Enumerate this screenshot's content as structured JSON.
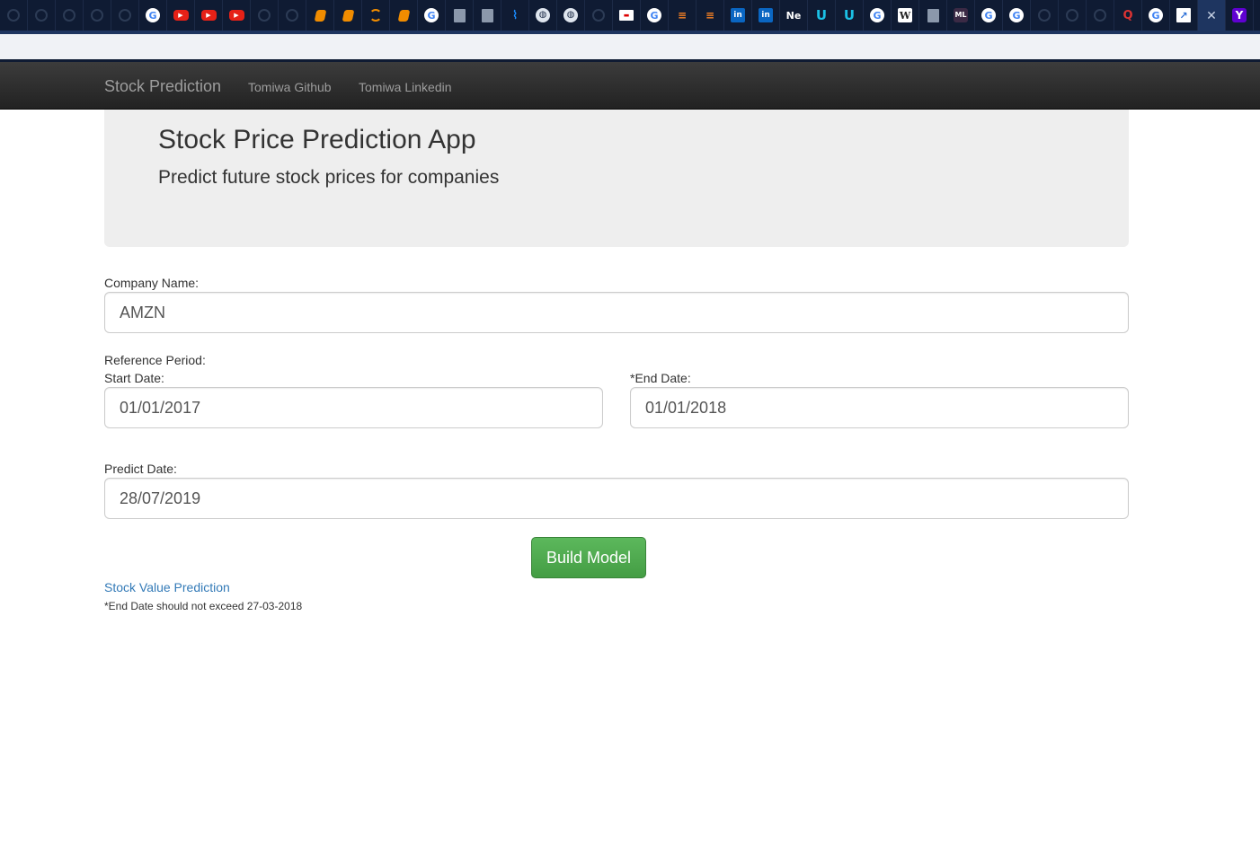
{
  "browser": {
    "tabs": [
      {
        "icon": "github-icon",
        "glyph": ""
      },
      {
        "icon": "github-icon",
        "glyph": ""
      },
      {
        "icon": "github-icon",
        "glyph": ""
      },
      {
        "icon": "github-icon",
        "glyph": ""
      },
      {
        "icon": "github-icon",
        "glyph": ""
      },
      {
        "icon": "google-icon",
        "glyph": "G"
      },
      {
        "icon": "youtube-icon",
        "glyph": "▶"
      },
      {
        "icon": "youtube-icon",
        "glyph": "▶"
      },
      {
        "icon": "youtube-icon",
        "glyph": "▶"
      },
      {
        "icon": "github-icon",
        "glyph": ""
      },
      {
        "icon": "github-icon",
        "glyph": ""
      },
      {
        "icon": "book-icon",
        "glyph": ""
      },
      {
        "icon": "book-icon",
        "glyph": ""
      },
      {
        "icon": "loader-icon",
        "glyph": ""
      },
      {
        "icon": "book-icon",
        "glyph": ""
      },
      {
        "icon": "google-icon",
        "glyph": "G"
      },
      {
        "icon": "document-icon",
        "glyph": ""
      },
      {
        "icon": "document-icon",
        "glyph": ""
      },
      {
        "icon": "chart-icon",
        "glyph": "⌇"
      },
      {
        "icon": "globe-icon",
        "glyph": "◍"
      },
      {
        "icon": "globe-icon",
        "glyph": "◍"
      },
      {
        "icon": "github-icon",
        "glyph": ""
      },
      {
        "icon": "red-banner-icon",
        "glyph": "▬"
      },
      {
        "icon": "google-icon",
        "glyph": "G"
      },
      {
        "icon": "stackoverflow-icon",
        "glyph": "≡"
      },
      {
        "icon": "stackoverflow-icon",
        "glyph": "≡"
      },
      {
        "icon": "linkedin-icon",
        "glyph": "in"
      },
      {
        "icon": "linkedin-icon",
        "glyph": "in"
      },
      {
        "icon": "ne-icon",
        "glyph": "Ne"
      },
      {
        "icon": "udacity-icon",
        "glyph": "U"
      },
      {
        "icon": "udacity-icon",
        "glyph": "U"
      },
      {
        "icon": "google-icon",
        "glyph": "G"
      },
      {
        "icon": "wikipedia-icon",
        "glyph": "W"
      },
      {
        "icon": "document-icon",
        "glyph": ""
      },
      {
        "icon": "ml-icon",
        "glyph": "ML"
      },
      {
        "icon": "google-icon",
        "glyph": "G"
      },
      {
        "icon": "google-icon",
        "glyph": "G"
      },
      {
        "icon": "github-icon",
        "glyph": ""
      },
      {
        "icon": "github-icon",
        "glyph": ""
      },
      {
        "icon": "github-icon",
        "glyph": ""
      },
      {
        "icon": "quora-icon",
        "glyph": "Q"
      },
      {
        "icon": "google-icon",
        "glyph": "G"
      },
      {
        "icon": "trend-icon",
        "glyph": "↗"
      },
      {
        "icon": "close-icon",
        "glyph": "✕",
        "active": true
      },
      {
        "icon": "yahoo-icon",
        "glyph": "Y"
      }
    ]
  },
  "navbar": {
    "brand": "Stock Prediction",
    "links": [
      "Tomiwa Github",
      "Tomiwa Linkedin"
    ]
  },
  "jumbotron": {
    "title": "Stock Price Prediction App",
    "subtitle": "Predict future stock prices for companies"
  },
  "form": {
    "company_label": "Company Name:",
    "company_value": "AMZN",
    "reference_label": "Reference Period:",
    "start_label": "Start Date:",
    "start_value": "01/01/2017",
    "end_label": "*End Date:",
    "end_value": "01/01/2018",
    "predict_label": "Predict Date:",
    "predict_value": "28/07/2019",
    "build_button": "Build Model"
  },
  "result_link": "Stock Value Prediction",
  "note": "*End Date should not exceed 27-03-2018",
  "colors": {
    "navbar": "#222222",
    "jumbotron": "#eeeeee",
    "button": "#5cb85c",
    "link": "#337ab7",
    "tabstrip": "#0f1b33"
  }
}
